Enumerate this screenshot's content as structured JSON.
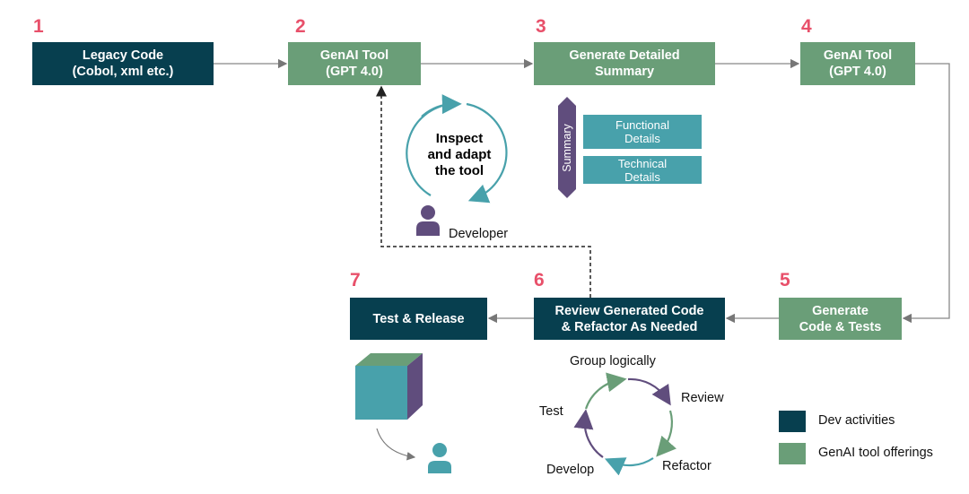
{
  "steps": [
    {
      "number": "1",
      "label": "Legacy Code\n(Cobol, xml etc.)",
      "category": "dev"
    },
    {
      "number": "2",
      "label": "GenAI Tool\n(GPT 4.0)",
      "category": "genai"
    },
    {
      "number": "3",
      "label": "Generate Detailed\nSummary",
      "category": "genai"
    },
    {
      "number": "4",
      "label": "GenAI Tool\n(GPT 4.0)",
      "category": "genai"
    },
    {
      "number": "5",
      "label": "Generate\nCode & Tests",
      "category": "genai"
    },
    {
      "number": "6",
      "label": "Review Generated Code\n& Refactor As Needed",
      "category": "dev"
    },
    {
      "number": "7",
      "label": "Test & Release",
      "category": "dev"
    }
  ],
  "inspect": {
    "label": "Inspect\nand adapt\nthe tool",
    "role": "Developer"
  },
  "summary": {
    "label": "Summary",
    "items": [
      "Functional\nDetails",
      "Technical\nDetails"
    ]
  },
  "cycle": [
    "Group logically",
    "Review",
    "Refactor",
    "Develop",
    "Test"
  ],
  "legend": [
    {
      "label": "Dev activities",
      "color": "#073f4f"
    },
    {
      "label": "GenAI tool offerings",
      "color": "#6a9e78"
    }
  ],
  "colors": {
    "dev": "#073f4f",
    "genai": "#6a9e78",
    "number": "#e8506a",
    "teal": "#48a1ab",
    "purple": "#604d7d"
  }
}
